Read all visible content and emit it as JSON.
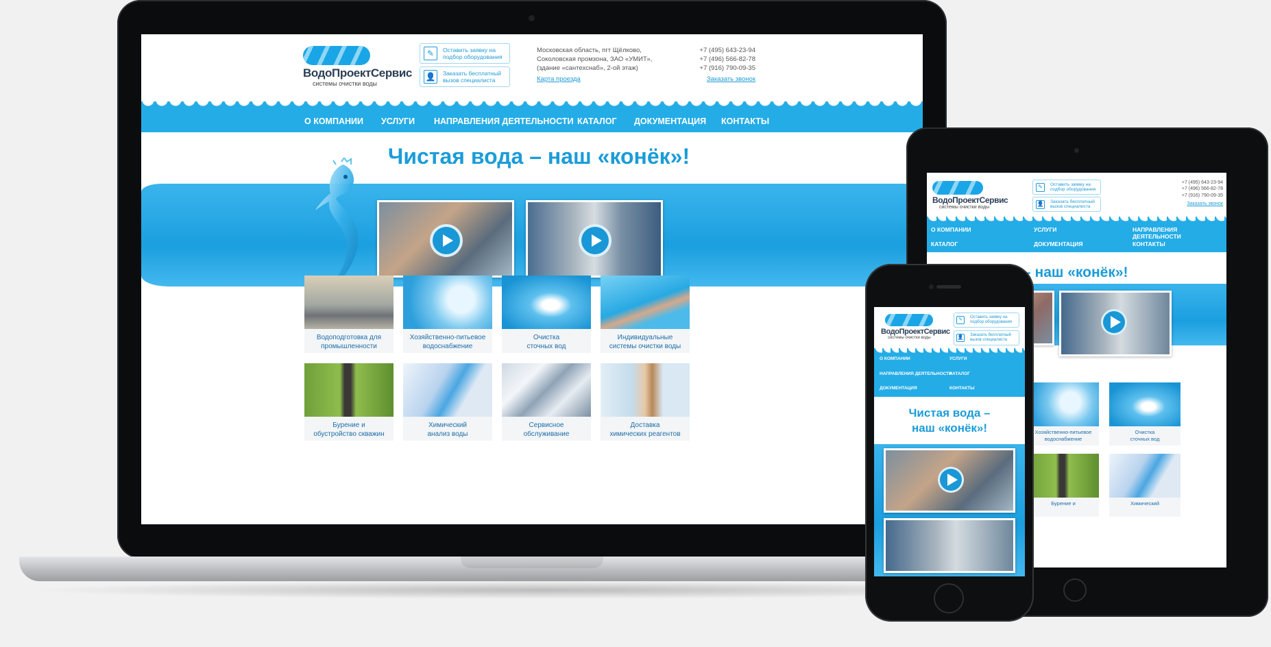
{
  "site": {
    "logo_name": "ВодоПроектСервис",
    "logo_sub": "системы очистки воды",
    "btn_request": "Оставить заявку на подбор оборудования",
    "btn_specialist": "Заказать бесплатный вызов специалиста",
    "address": [
      "Московская область, пгт Щёлково,",
      "Соколовская промзона, ЗАО «УМИТ»,",
      "(здание «сантехснаб», 2-ой этаж)"
    ],
    "map_link": "Карта проезда",
    "phones": [
      "+7 (495) 643-23-94",
      "+7 (496) 566-82-78",
      "+7 (916) 790-09-35"
    ],
    "callback_link": "Заказать звонок",
    "nav": [
      "О КОМПАНИИ",
      "УСЛУГИ",
      "НАПРАВЛЕНИЯ ДЕЯТЕЛЬНОСТИ",
      "КАТАЛОГ",
      "ДОКУМЕНТАЦИЯ",
      "КОНТАКТЫ"
    ],
    "hero_title": "Чистая вода – наш «конёк»!",
    "hero_title_l1": "Чистая вода –",
    "hero_title_l2": "наш «конёк»!",
    "hero_title_tab": "– наш «конёк»!",
    "cards": [
      {
        "l1": "Водоподготовка для",
        "l2": "промышленности"
      },
      {
        "l1": "Хозяйственно-питьевое",
        "l2": "водоснабжение"
      },
      {
        "l1": "Очистка",
        "l2": "сточных вод"
      },
      {
        "l1": "Индивидуальные",
        "l2": "системы очистки воды"
      },
      {
        "l1": "Бурение и",
        "l2": "обустройство скважин"
      },
      {
        "l1": "Химический",
        "l2": "анализ воды"
      },
      {
        "l1": "Сервисное",
        "l2": "обслуживание"
      },
      {
        "l1": "Доставка",
        "l2": "химических реагентов"
      }
    ]
  },
  "icons": {
    "request": "edit-icon",
    "specialist": "person-icon",
    "play": "play-icon"
  },
  "colors": {
    "brand_blue": "#24ace7",
    "title_blue": "#1b9cd8",
    "caption_blue": "#1d6ea7",
    "device_black": "#0b0c0e"
  }
}
